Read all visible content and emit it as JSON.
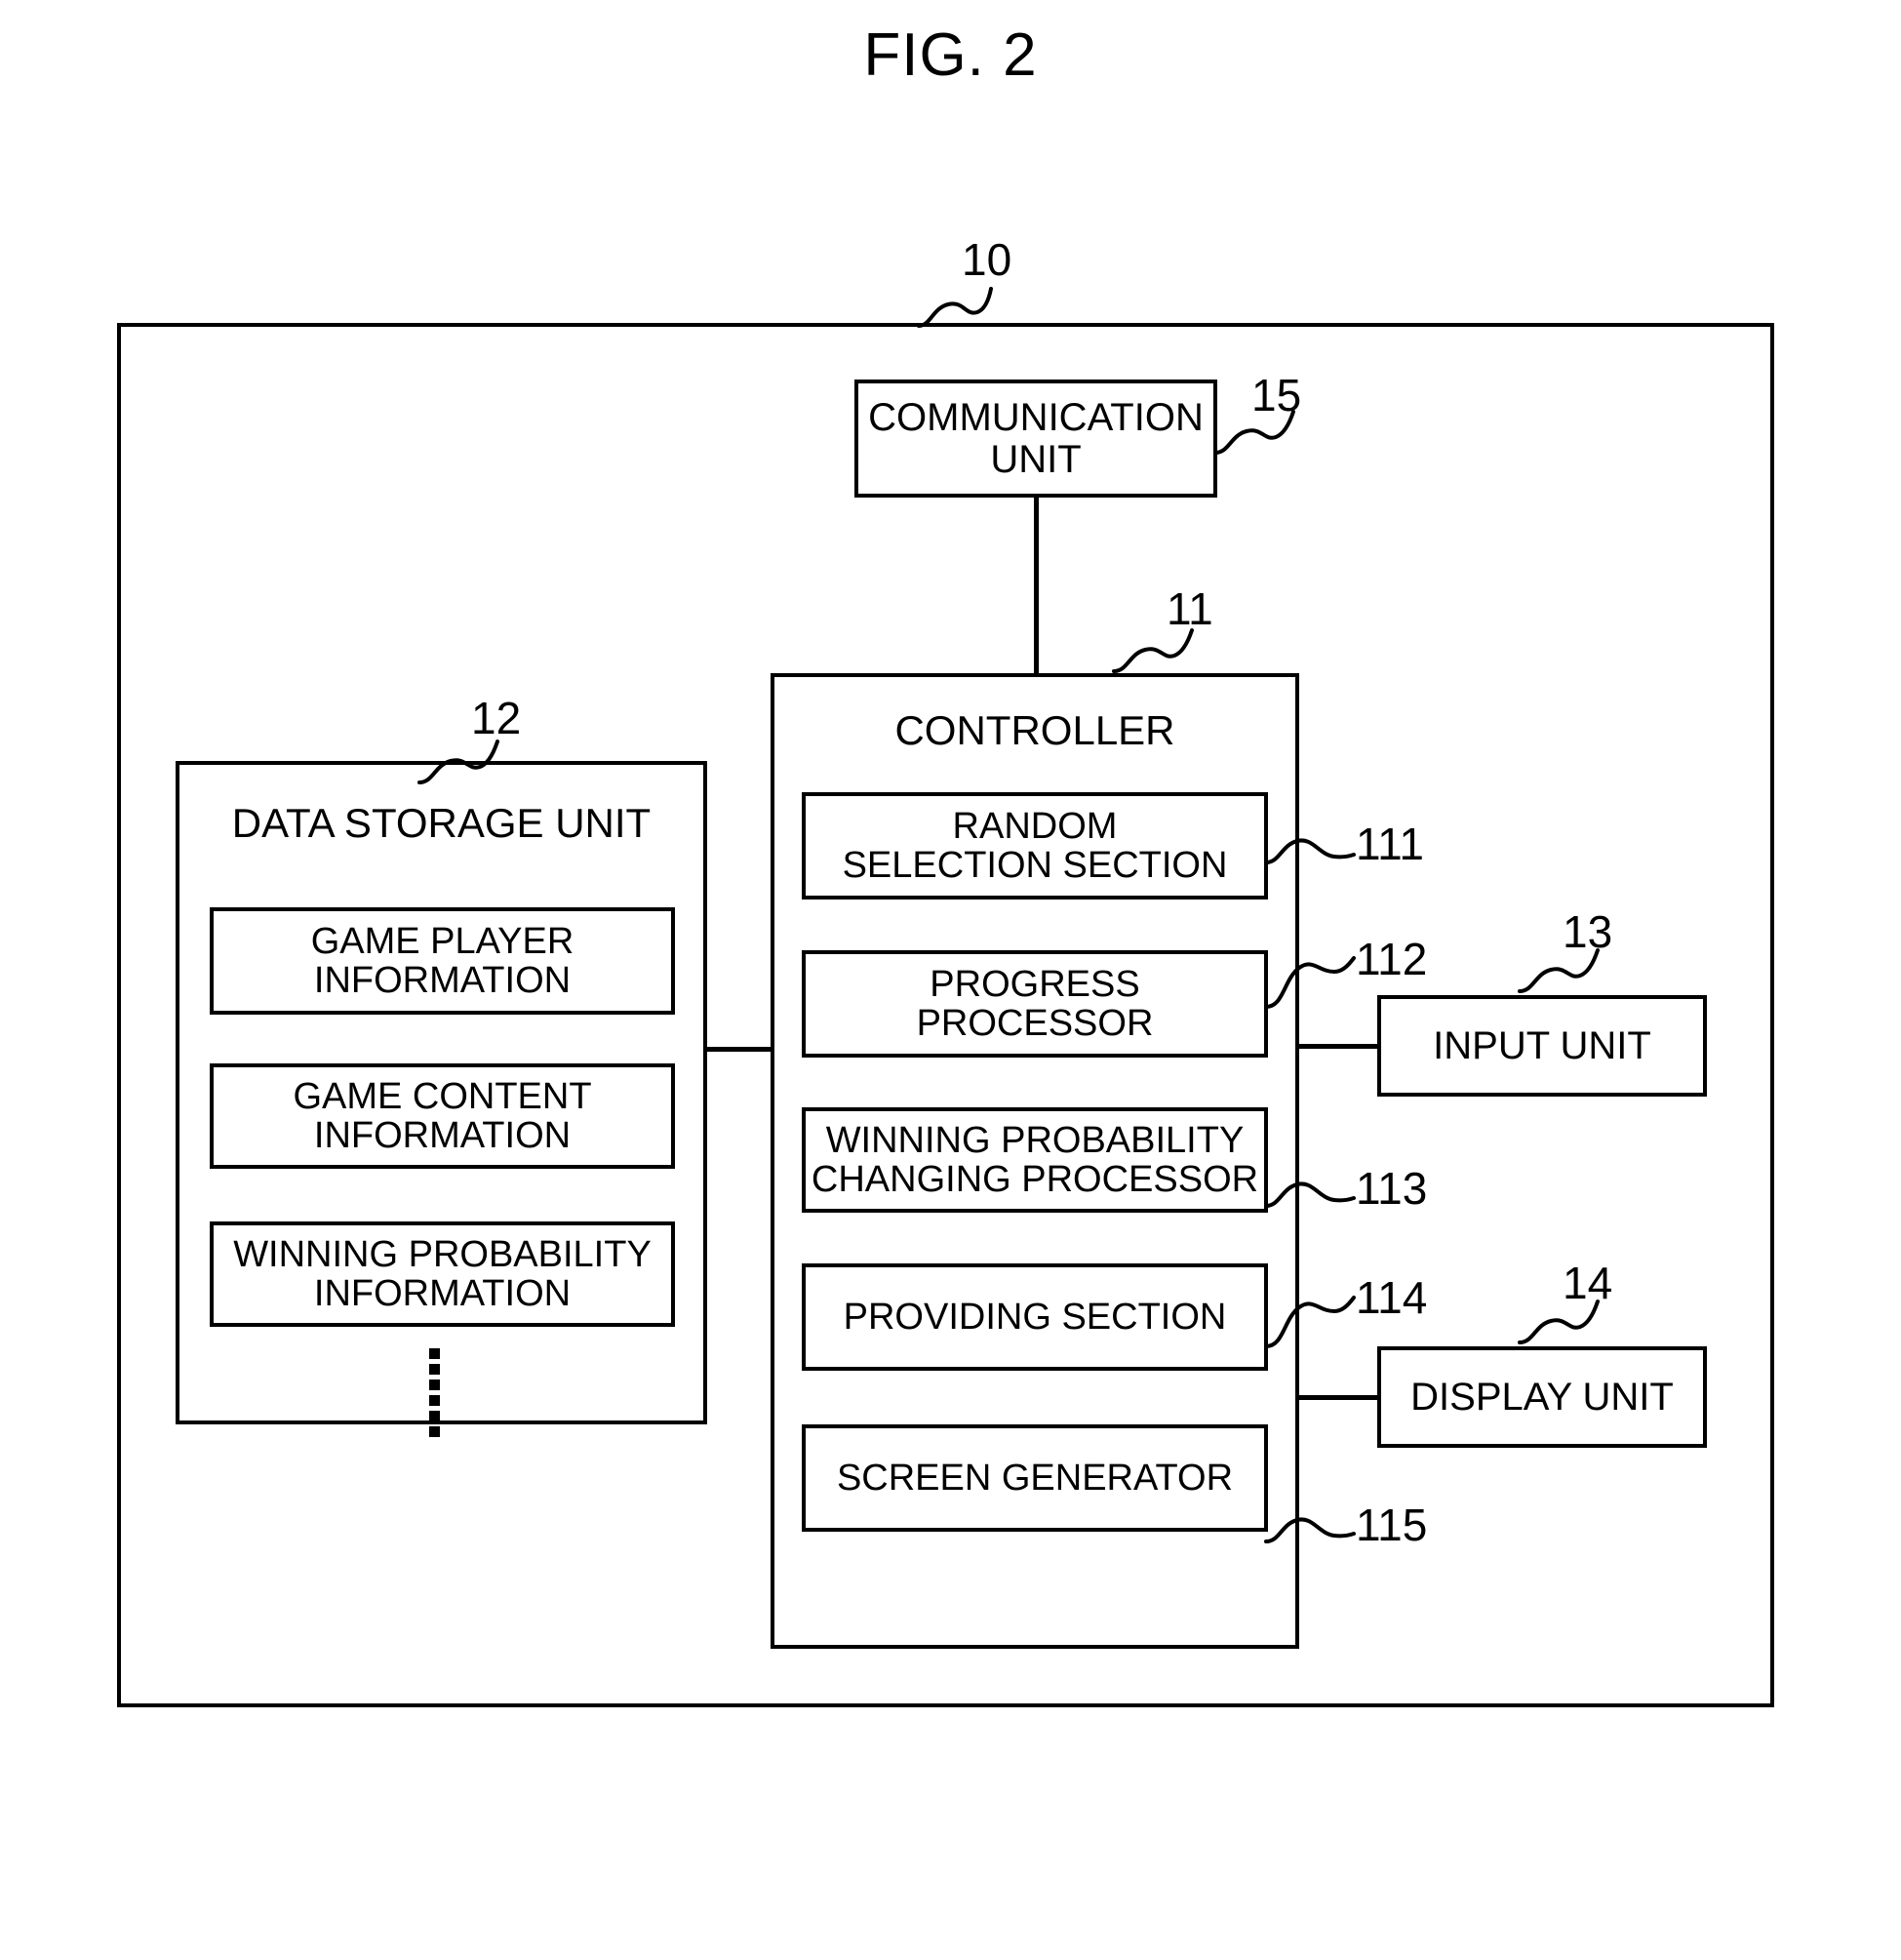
{
  "figure": {
    "title": "FIG. 2",
    "type": "patent-block-diagram"
  },
  "system": {
    "ref": "10",
    "label": ""
  },
  "communication_unit": {
    "label": "COMMUNICATION\nUNIT",
    "ref": "15"
  },
  "controller": {
    "label": "CONTROLLER",
    "ref": "11",
    "sections": [
      {
        "label": "RANDOM\nSELECTION SECTION",
        "ref": "111"
      },
      {
        "label": "PROGRESS\nPROCESSOR",
        "ref": "112"
      },
      {
        "label": "WINNING PROBABILITY\nCHANGING PROCESSOR",
        "ref": "113"
      },
      {
        "label": "PROVIDING SECTION",
        "ref": "114"
      },
      {
        "label": "SCREEN GENERATOR",
        "ref": "115"
      }
    ]
  },
  "data_storage_unit": {
    "label": "DATA STORAGE UNIT",
    "ref": "12",
    "items": [
      {
        "label": "GAME PLAYER\nINFORMATION"
      },
      {
        "label": "GAME CONTENT\nINFORMATION"
      },
      {
        "label": "WINNING PROBABILITY\nINFORMATION"
      }
    ],
    "ellipsis": "⋮"
  },
  "input_unit": {
    "label": "INPUT UNIT",
    "ref": "13"
  },
  "display_unit": {
    "label": "DISPLAY UNIT",
    "ref": "14"
  },
  "colors": {
    "stroke": "#000000",
    "background": "#ffffff"
  }
}
